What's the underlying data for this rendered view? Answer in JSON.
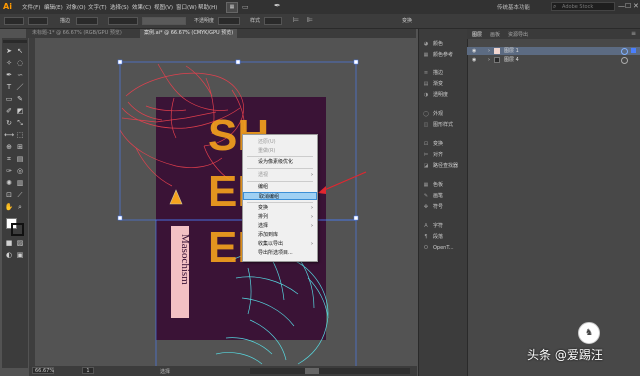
{
  "app": {
    "logo": "Ai"
  },
  "menubar": {
    "items": [
      "文件(F)",
      "编辑(E)",
      "对象(O)",
      "文字(T)",
      "选择(S)",
      "效果(C)",
      "视图(V)",
      "窗口(W)",
      "帮助(H)"
    ],
    "workspace": "传统基本功能",
    "search_placeholder": "Adobe Stock",
    "window_buttons": [
      "—",
      "☐",
      "✕"
    ]
  },
  "controlbar": {
    "stroke_label": "描边",
    "opacity_label": "不透明度",
    "style_label": "样式",
    "transform_label": "变换"
  },
  "tabs": [
    {
      "label": "未标题-1* @ 66.67% (RGB/GPU 预览)"
    },
    {
      "label": "案例.ai* @ 66.67% (CMYK/GPU 预览)"
    }
  ],
  "statusbar": {
    "zoom": "66.67%",
    "page": "1",
    "tool": "选择"
  },
  "context_menu": {
    "items": [
      {
        "label": "还原(U)",
        "disabled": true
      },
      {
        "label": "重做(R)",
        "disabled": true
      },
      {
        "label": "设为像素级优化",
        "disabled": false
      },
      {
        "label": "透视",
        "disabled": true,
        "submenu": true
      },
      {
        "label": "编组",
        "disabled": false
      },
      {
        "label": "取消编组",
        "disabled": false,
        "highlighted": true
      },
      {
        "label": "变换",
        "disabled": false,
        "submenu": true
      },
      {
        "label": "排列",
        "disabled": false,
        "submenu": true
      },
      {
        "label": "选择",
        "disabled": false,
        "submenu": true
      },
      {
        "label": "添加到库",
        "disabled": false
      },
      {
        "label": "收集以导出",
        "disabled": false,
        "submenu": true
      },
      {
        "label": "导出所选项目...",
        "disabled": false
      }
    ]
  },
  "panels": {
    "items": [
      "颜色",
      "颜色参考",
      "描边",
      "渐变",
      "透明度",
      "外观",
      "图形样式",
      "变换",
      "对齐",
      "路径查找器",
      "色板",
      "画笔",
      "符号",
      "字符",
      "段落",
      "OpenT..."
    ]
  },
  "layers_panel": {
    "tabs": [
      "图层",
      "画板",
      "资源导出"
    ],
    "layers": [
      {
        "name": "图层 1"
      },
      {
        "name": "图层 4"
      }
    ]
  },
  "artwork": {
    "title_letters": [
      "SH",
      "EL",
      "ER"
    ],
    "vertical_text": "Masochism",
    "colors": {
      "background": "#3a1336",
      "accent": "#f6a21d",
      "red_lines": "#e8404e",
      "cyan_lines": "#58e0e8",
      "pink_box": "#f3c1c4"
    }
  },
  "watermark": {
    "text": "头条 @爱踢汪",
    "logo": "♞"
  }
}
